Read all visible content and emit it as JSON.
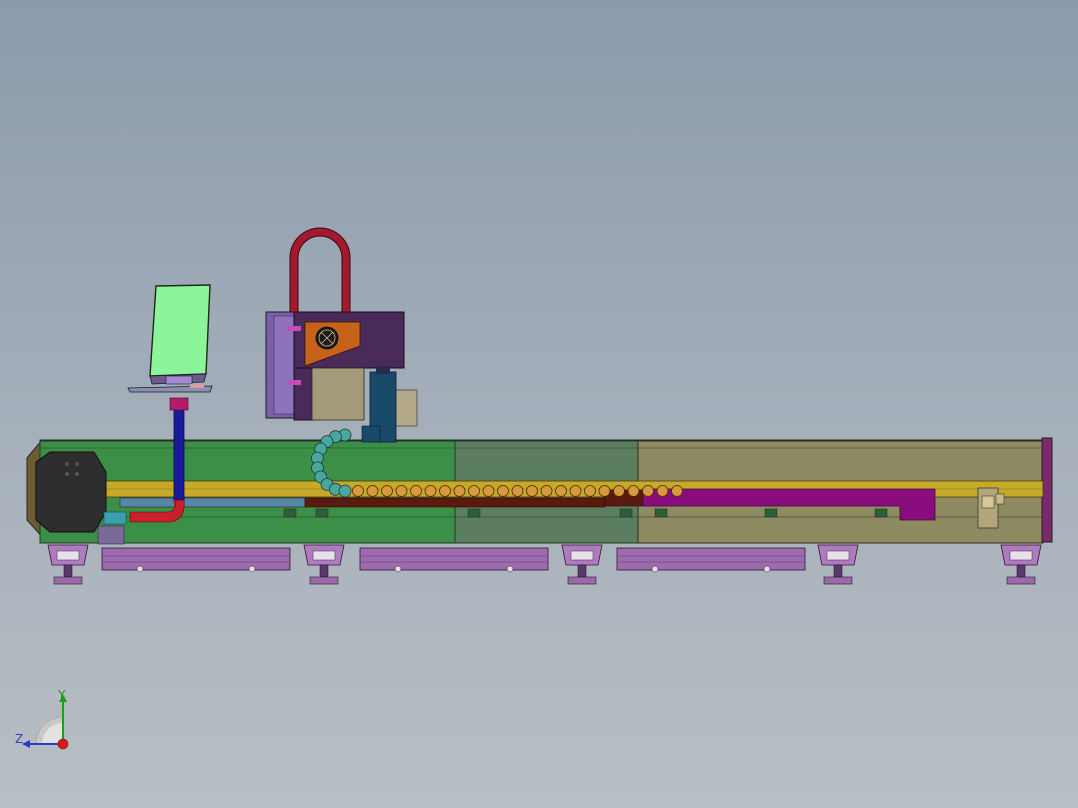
{
  "viewport": {
    "background_top": "#8c9aab",
    "background_bottom": "#b8bec5"
  },
  "model": {
    "components": [
      "bed-frame",
      "feed-end-door",
      "control-panel-monitor",
      "monitor-support-column",
      "laser-head-gantry",
      "cable-loop-handle",
      "cooling-fan",
      "drag-chain",
      "linear-rail",
      "exhaust-duct",
      "support-feet",
      "bottom-trays",
      "pneumatic-unit"
    ],
    "colors": {
      "bed_green": "#3b8f47",
      "bed_gray_green": "#5c7e60",
      "bed_khaki": "#8e8a62",
      "rail_yellow": "#c7a92a",
      "duct_magenta": "#8a0d7d",
      "duct_brown": "#5a1a10",
      "monitor_screen": "#8cf59a",
      "head_purple": "#4a2a58",
      "head_orange": "#c7621a",
      "loop_red": "#a41a2c",
      "chain_teal": "#4aa79e",
      "chain_orange": "#d59a3a",
      "column_blue": "#1a1a9a",
      "feet_purple": "#a06ab0"
    }
  },
  "triad": {
    "y_label": "Y",
    "z_label": "Z",
    "x_color": "#d81a1a",
    "y_color": "#1aa01a",
    "z_color": "#2a3ac9"
  }
}
